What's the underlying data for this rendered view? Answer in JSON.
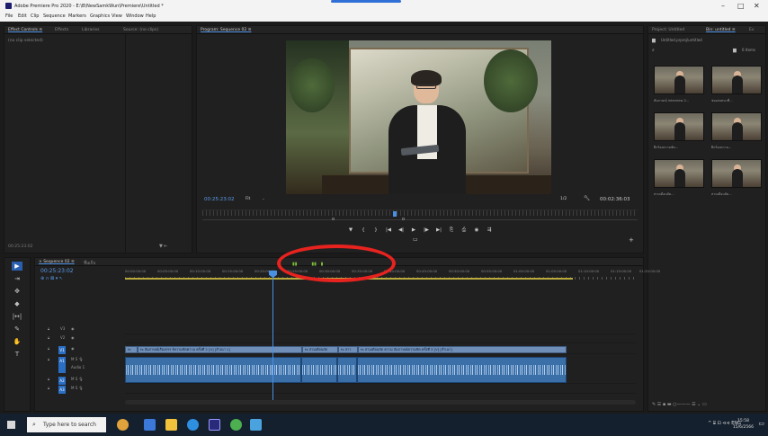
{
  "window": {
    "title": "Adobe Premiere Pro 2020 - E:\\B\\NewSamkWun\\Premiere\\Untitled *",
    "controls": [
      "–",
      "□",
      "✕"
    ]
  },
  "menu": [
    "File",
    "Edit",
    "Clip",
    "Sequence",
    "Markers",
    "Graphics",
    "View",
    "Window",
    "Help"
  ],
  "effect_panel": {
    "tabs": [
      "Effect Controls ≡",
      "Effects",
      "Libraries",
      "Source: (no clips)"
    ],
    "empty_text": "(no clip selected)",
    "bottom_timecode": "00:25:23:02"
  },
  "program_panel": {
    "tab": "Program: Sequence 02 ≡",
    "current_time": "00:25:23:02",
    "fit_label": "Fit",
    "zoom_ratio": "1/2",
    "duration": "00:02:36:03",
    "transport": [
      "▼",
      "{",
      "}",
      "|◀",
      "◀|",
      "▶",
      "|▶",
      "▶|",
      "⎘",
      "⎙",
      "◉",
      "⇶"
    ]
  },
  "project_panel": {
    "tabs": [
      "Project: Untitled",
      "Bin: untitled ≡",
      "Ev"
    ],
    "bin_path": "Untitled.prproj\\untitled",
    "item_count": "6 Items",
    "items": [
      {
        "label": "สัมภาษณ์ interview 2...",
        "duration": "1:32:13"
      },
      {
        "label": "ช่องสนทนาที่...",
        "duration": "4:25:02"
      },
      {
        "label": "ฝึกร้องความชัด...",
        "duration": "1:30:16"
      },
      {
        "label": "ฝึกร้องความ...",
        "duration": "1:10:07"
      },
      {
        "label": "สามเดือนถัด...",
        "duration": "1:13:29"
      },
      {
        "label": "สามเดือนถัด...",
        "duration": "1:16:09"
      }
    ]
  },
  "tools": [
    "▶",
    "⇥",
    "✥",
    "◆",
    "|↔|",
    "✎",
    "✋",
    "T"
  ],
  "timeline": {
    "tab": "× Sequence 02 ≡",
    "tab2": "ชิ้นเก็บ",
    "timecode": "00:25:23:02",
    "ruler": [
      "00:00:00:00",
      "00:05:00:00",
      "00:10:00:00",
      "00:15:00:00",
      "00:20:00:00",
      "00:25:00:00",
      "00:30:00:00",
      "00:35:00:00",
      "00:40:00:00",
      "00:45:00:00",
      "00:50:00:00",
      "00:55:00:00",
      "01:00:00:00",
      "01:05:00:00",
      "01:10:00:00",
      "01:15:00:00",
      "01:20:00:00"
    ],
    "video_tracks": [
      "V3",
      "V2",
      "V1"
    ],
    "audio_tracks": [
      "A1",
      "A2",
      "A3"
    ],
    "audio_label": "Audio 1",
    "clips_v1": [
      "fx",
      "fx  สัมภาษณ์เรื่องกรร ร์ความชัดความ ครั้งที่ 2 [V] [สำเนา 1]",
      "fx  สามเดือนถัด",
      "fx  สาว",
      "fx  สามเดือนถัด ความ สัมภาษณ์ความชัด ครั้งที่ 3 [V] [สำเนา]"
    ]
  },
  "taskbar": {
    "search_placeholder": "Type here to search",
    "tray": "^ ⌸ ⊡ ⊲⊲ ENG",
    "time": "15:58",
    "date": "15/6/2566"
  },
  "colors": {
    "accent": "#4a8fe2",
    "highlight": "#e8231f",
    "clip_video": "#6f8fb8",
    "clip_audio": "#3b6fa8",
    "work_area": "#b8a93a"
  }
}
